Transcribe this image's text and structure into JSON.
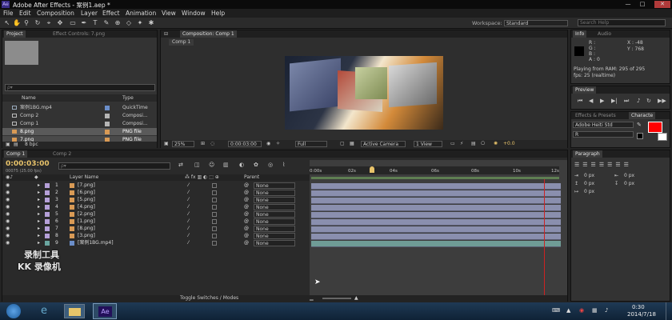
{
  "app": {
    "title": "Adobe After Effects - 案例1.aep *",
    "icon": "Ae"
  },
  "menu": [
    "File",
    "Edit",
    "Composition",
    "Layer",
    "Effect",
    "Animation",
    "View",
    "Window",
    "Help"
  ],
  "workspace": {
    "label": "Workspace:",
    "value": "Standard"
  },
  "search_help": {
    "placeholder": "Search Help"
  },
  "project_panel": {
    "tabs": [
      "Project",
      "Effect Controls: 7.png"
    ],
    "search_placeholder": "ρ▾",
    "columns": {
      "name": "Name",
      "type": "Type"
    },
    "items": [
      {
        "name": "案例1BG.mp4",
        "type": "QuickTime",
        "color": "#6b8ec9"
      },
      {
        "name": "Comp 2",
        "type": "Composi...",
        "color": "#b5b5b5"
      },
      {
        "name": "Comp 1",
        "type": "Composi...",
        "color": "#b5b5b5"
      },
      {
        "name": "8.png",
        "type": "PNG file",
        "color": "#d99a55"
      },
      {
        "name": "7.png",
        "type": "PNG file",
        "color": "#d99a55"
      }
    ],
    "bpc": "8 bpc"
  },
  "comp_panel": {
    "tab": "Composition: Comp 1",
    "subtab": "Comp 1",
    "zoom": "25%",
    "timecode": "0:00:03:00",
    "resolution": "Full",
    "camera": "Active Camera",
    "views": "1 View",
    "exposure": "+0.0"
  },
  "info_panel": {
    "tabs": [
      "Info",
      "Audio"
    ],
    "r": "R :",
    "g": "G :",
    "b": "B :",
    "a": "A : 0",
    "x": "X : -48",
    "y": "Y : 768",
    "playing": "Playing from RAM: 295 of 295",
    "fps": "fps: 25 (realtime)"
  },
  "preview_panel": {
    "tab": "Preview"
  },
  "effects_panel": {
    "tabs": [
      "Effects & Presets",
      "Characte"
    ],
    "font": "Adobe Heiti Std",
    "style": "R"
  },
  "paragraph_panel": {
    "tab": "Paragraph",
    "values": [
      "0 px",
      "0 px",
      "0 px",
      "0 px",
      "0 px"
    ]
  },
  "timeline": {
    "tabs": [
      "Comp 1",
      "Comp 2"
    ],
    "timecode": "0:00:03:00",
    "frames": "00075 (25.00 fps)",
    "search_placeholder": "ρ▾",
    "header": {
      "layer_name": "Layer Name",
      "parent": "Parent"
    },
    "layers": [
      {
        "num": "1",
        "name": "[7.png]",
        "parent": "None"
      },
      {
        "num": "2",
        "name": "[6.png]",
        "parent": "None"
      },
      {
        "num": "3",
        "name": "[5.png]",
        "parent": "None"
      },
      {
        "num": "4",
        "name": "[4.png]",
        "parent": "None"
      },
      {
        "num": "5",
        "name": "[2.png]",
        "parent": "None"
      },
      {
        "num": "6",
        "name": "[1.png]",
        "parent": "None"
      },
      {
        "num": "7",
        "name": "[8.png]",
        "parent": "None"
      },
      {
        "num": "8",
        "name": "[3.png]",
        "parent": "None"
      },
      {
        "num": "9",
        "name": "[案例1BG.mp4]",
        "parent": "None"
      }
    ],
    "ruler": [
      "0:00s",
      "02s",
      "04s",
      "06s",
      "08s",
      "10s",
      "12s"
    ],
    "toggle": "Toggle Switches / Modes"
  },
  "watermark": {
    "line1": "录制工具",
    "line2": "KK 录像机"
  },
  "taskbar": {
    "time": "0:30",
    "date": "2014/7/18",
    "app": "Ae"
  },
  "colors": {
    "accent": "#e8c36a",
    "fill": "#ff0000",
    "bar": "#8a8fae",
    "playhead": "#cc2222"
  }
}
